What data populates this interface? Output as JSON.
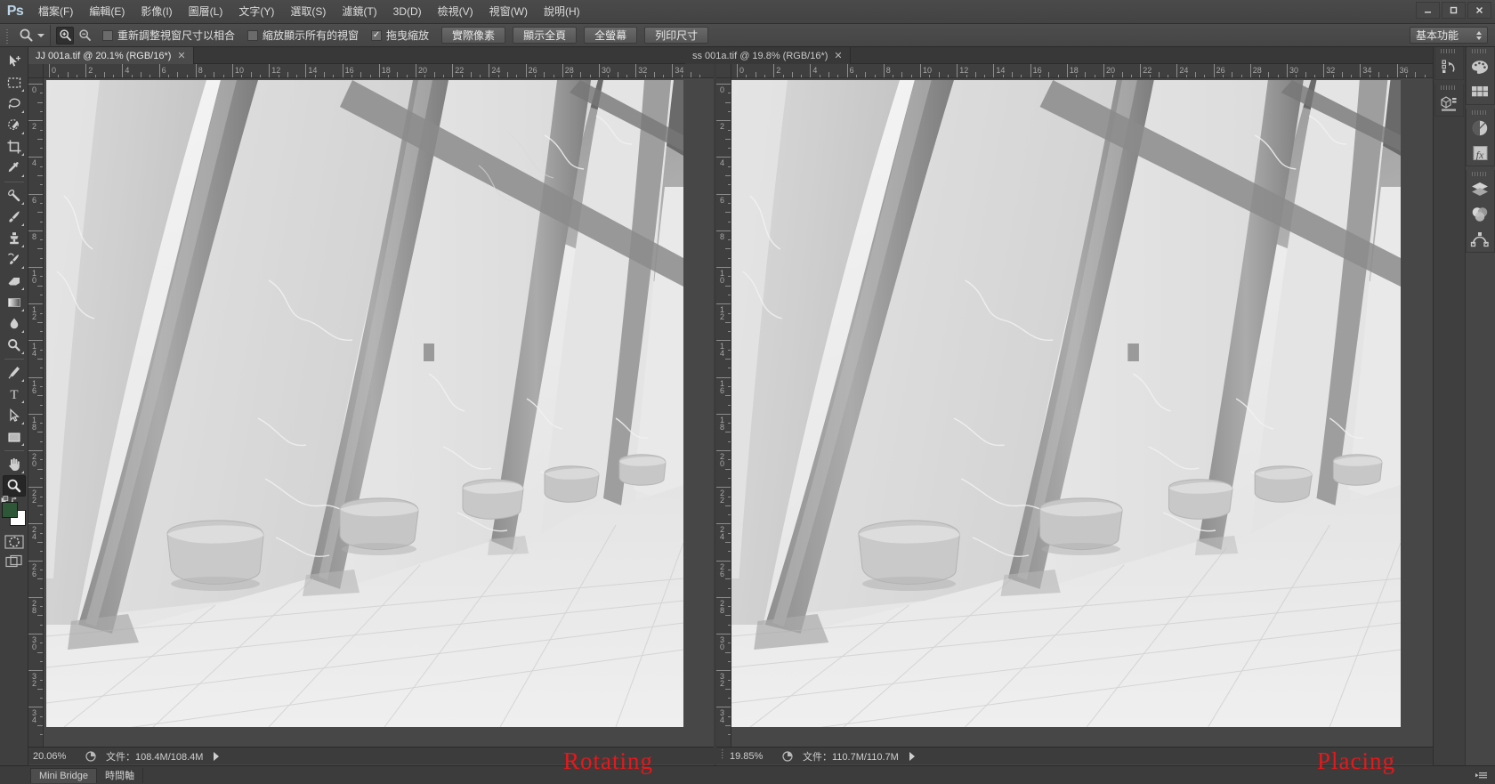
{
  "app": {
    "name": "Ps",
    "logo": "Ps"
  },
  "menubar": {
    "items": [
      {
        "label": "檔案(F)"
      },
      {
        "label": "編輯(E)"
      },
      {
        "label": "影像(I)"
      },
      {
        "label": "圖層(L)"
      },
      {
        "label": "文字(Y)"
      },
      {
        "label": "選取(S)"
      },
      {
        "label": "濾鏡(T)"
      },
      {
        "label": "3D(D)"
      },
      {
        "label": "檢視(V)"
      },
      {
        "label": "視窗(W)"
      },
      {
        "label": "說明(H)"
      }
    ],
    "window_controls": [
      {
        "name": "minimize",
        "glyph": "—"
      },
      {
        "name": "maximize",
        "glyph": "▢"
      },
      {
        "name": "close",
        "glyph": "✕"
      }
    ]
  },
  "options_bar": {
    "tool_icon": "zoom-icon",
    "zoom_in_label": "zoom-in",
    "zoom_out_label": "zoom-out",
    "checkboxes": [
      {
        "label": "重新調整視窗尺寸以相合",
        "checked": false
      },
      {
        "label": "縮放顯示所有的視窗",
        "checked": false
      },
      {
        "label": "拖曳縮放",
        "checked": true
      }
    ],
    "buttons": [
      {
        "label": "實際像素"
      },
      {
        "label": "顯示全頁"
      },
      {
        "label": "全螢幕"
      },
      {
        "label": "列印尺寸"
      }
    ],
    "workspace": "基本功能"
  },
  "toolbar": {
    "tools": [
      {
        "name": "move-tool",
        "has_submenu": false
      },
      {
        "name": "rectangular-marquee-tool",
        "has_submenu": true
      },
      {
        "name": "lasso-tool",
        "has_submenu": true
      },
      {
        "name": "quick-selection-tool",
        "has_submenu": true
      },
      {
        "name": "crop-tool",
        "has_submenu": true
      },
      {
        "name": "eyedropper-tool",
        "has_submenu": true
      },
      {
        "name": "spot-healing-brush-tool",
        "has_submenu": true
      },
      {
        "name": "brush-tool",
        "has_submenu": true
      },
      {
        "name": "clone-stamp-tool",
        "has_submenu": true
      },
      {
        "name": "history-brush-tool",
        "has_submenu": true
      },
      {
        "name": "eraser-tool",
        "has_submenu": true
      },
      {
        "name": "gradient-tool",
        "has_submenu": true
      },
      {
        "name": "blur-tool",
        "has_submenu": true
      },
      {
        "name": "dodge-tool",
        "has_submenu": true
      },
      {
        "name": "pen-tool",
        "has_submenu": true
      },
      {
        "name": "type-tool",
        "has_submenu": true
      },
      {
        "name": "path-selection-tool",
        "has_submenu": true
      },
      {
        "name": "rectangle-tool",
        "has_submenu": true
      },
      {
        "name": "hand-tool",
        "has_submenu": true
      },
      {
        "name": "zoom-tool",
        "has_submenu": false,
        "selected": true
      }
    ],
    "foreground_color": "#2d5736",
    "background_color": "#ffffff",
    "quick_mask_name": "quick-mask-mode",
    "screen_mode_name": "screen-mode"
  },
  "documents": [
    {
      "tab_label": "JJ 001a.tif @ 20.1% (RGB/16*)",
      "active": true,
      "zoom": "20.06%",
      "doc_size": "文件：108.4M/108.4M",
      "ruler_ticks": [
        0,
        2,
        4,
        6,
        8,
        10,
        12,
        14,
        16,
        18,
        20,
        22,
        24,
        26,
        28,
        30,
        32,
        34
      ],
      "annotation": "Rotating"
    },
    {
      "tab_label": "ss 001a.tif @ 19.8% (RGB/16*)",
      "active": false,
      "zoom": "19.85%",
      "doc_size": "文件：110.7M/110.7M",
      "ruler_ticks": [
        0,
        2,
        4,
        6,
        8,
        10,
        12,
        14,
        16,
        18,
        20,
        22,
        24,
        26,
        28,
        30,
        32,
        34,
        36
      ],
      "vruler_ticks": [
        0,
        2,
        4,
        6,
        8,
        10,
        12,
        14,
        16,
        18,
        20,
        22,
        24,
        26,
        28,
        30,
        32,
        34
      ],
      "annotation": "Placing"
    }
  ],
  "dock": {
    "left_column": [
      {
        "name": "history-panel-icon"
      },
      {
        "name": "3d-panel-icon"
      }
    ],
    "right_column": [
      {
        "name": "color-panel-icon"
      },
      {
        "name": "swatches-panel-icon"
      },
      {
        "name": "adjustments-panel-icon"
      },
      {
        "name": "styles-panel-icon"
      },
      {
        "name": "layers-panel-icon"
      },
      {
        "name": "channels-panel-icon"
      },
      {
        "name": "paths-panel-icon"
      }
    ],
    "collapse_icon": "collapse-panel-icon"
  },
  "taskbar": {
    "tabs": [
      {
        "label": "Mini Bridge",
        "active": true
      },
      {
        "label": "時間軸",
        "active": false
      }
    ]
  },
  "colors": {
    "chrome": "#454545",
    "panel": "#3f3f3f",
    "canvas_bg": "#474747",
    "annotation_red": "#e8171a",
    "accent_blue": "#bdd6e8"
  }
}
